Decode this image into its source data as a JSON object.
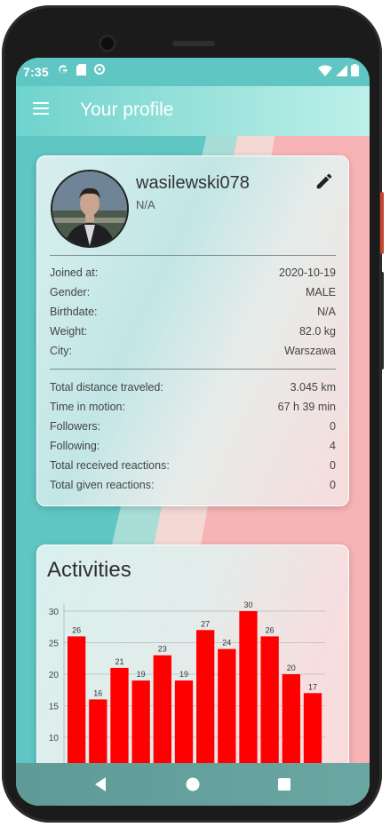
{
  "status": {
    "time": "7:35"
  },
  "appbar": {
    "title": "Your profile"
  },
  "profile": {
    "username": "wasilewski078",
    "subtitle": "N/A",
    "details": [
      {
        "label": "Joined at:",
        "value": "2020-10-19"
      },
      {
        "label": "Gender:",
        "value": "MALE"
      },
      {
        "label": "Birthdate:",
        "value": "N/A"
      },
      {
        "label": "Weight:",
        "value": "82.0 kg"
      },
      {
        "label": "City:",
        "value": "Warszawa"
      }
    ],
    "stats": [
      {
        "label": "Total distance traveled:",
        "value": "3.045 km"
      },
      {
        "label": "Time in motion:",
        "value": "67 h 39 min"
      },
      {
        "label": "Followers:",
        "value": "0"
      },
      {
        "label": "Following:",
        "value": "4"
      },
      {
        "label": "Total received reactions:",
        "value": "0"
      },
      {
        "label": "Total given reactions:",
        "value": "0"
      }
    ]
  },
  "activities": {
    "title": "Activities"
  },
  "chart_data": {
    "type": "bar",
    "values": [
      26,
      16,
      21,
      19,
      23,
      19,
      27,
      24,
      30,
      26,
      20,
      17
    ],
    "y_ticks": [
      30,
      25,
      20,
      15,
      10
    ],
    "bar_color": "#ff0000",
    "grid": true
  },
  "icons": {
    "menu": "menu-icon",
    "edit": "pencil-icon",
    "back": "back-triangle-icon",
    "home": "home-circle-icon",
    "recents": "recents-square-icon"
  },
  "colors": {
    "appbar_start": "#6fd3cd",
    "teal_background": "#5fc6c3",
    "pink_background": "#f7b3b5",
    "navbar": "#64a09b"
  }
}
